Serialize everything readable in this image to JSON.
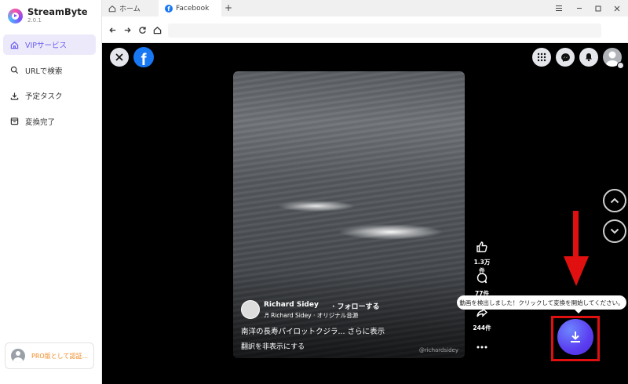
{
  "app": {
    "name": "StreamByte",
    "version": "2.0.1"
  },
  "sidebar": {
    "items": [
      {
        "label": "VIPサービス",
        "icon": "home-icon",
        "active": true
      },
      {
        "label": "URLで検索",
        "icon": "search-icon",
        "active": false
      },
      {
        "label": "予定タスク",
        "icon": "download-icon",
        "active": false
      },
      {
        "label": "変換完了",
        "icon": "archive-icon",
        "active": false
      }
    ],
    "pro_label": "PRO版として認証..."
  },
  "tabs": [
    {
      "label": "ホーム",
      "icon": "home-icon",
      "active": false
    },
    {
      "label": "Facebook",
      "icon": "facebook-icon",
      "active": true
    }
  ],
  "url": {
    "value": ""
  },
  "video": {
    "author": "Richard Sidey",
    "follow": "· フォローする",
    "audio": "♬ Richard Sidey · オリジナル音源",
    "caption": "南洋の長寿パイロットクジラ... さらに表示",
    "translate": "翻訳を非表示にする",
    "watermark": "@richardsidey"
  },
  "actions": {
    "likes": "1.3万件",
    "comments": "77件",
    "shares": "244件"
  },
  "tooltip": "動画を検出しました！クリックして変換を開始してください。",
  "colors": {
    "accent": "#6a5cf0",
    "facebook": "#1877f2",
    "highlight": "#e01010",
    "pro": "#f08a24"
  }
}
